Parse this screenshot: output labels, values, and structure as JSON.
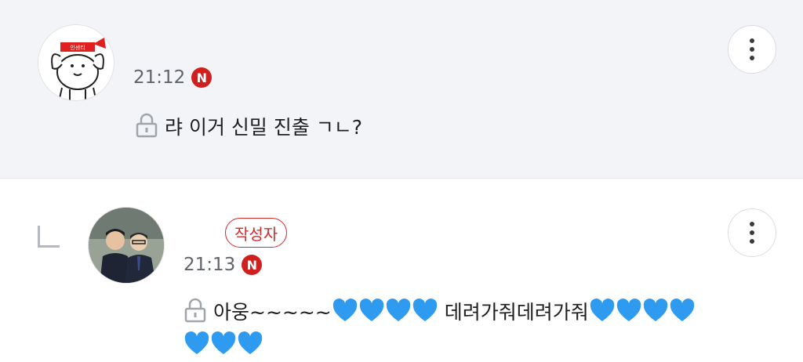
{
  "comments": [
    {
      "time": "21:12",
      "badge": "N",
      "text": "랴 이거 신밀 진출 ㄱㄴ?",
      "avatar_headband_text": "인센티",
      "avatar_icon": "dog-character-avatar",
      "lock_icon": "lock-icon"
    },
    {
      "is_reply": true,
      "author_tag": "작성자",
      "time": "21:13",
      "badge": "N",
      "text_prefix": "아웅~~~~~",
      "text_middle": " 데려가줘데려가줘",
      "hearts_first": 4,
      "hearts_second": 4,
      "hearts_third": 3,
      "heart_color": "#2f9bf0",
      "avatar_icon": "profile-photo-avatar",
      "lock_icon": "lock-icon"
    }
  ],
  "colors": {
    "highlight_bg": "#f2f4f8",
    "badge_red": "#d11f1f",
    "author_red": "#d52a2a"
  }
}
